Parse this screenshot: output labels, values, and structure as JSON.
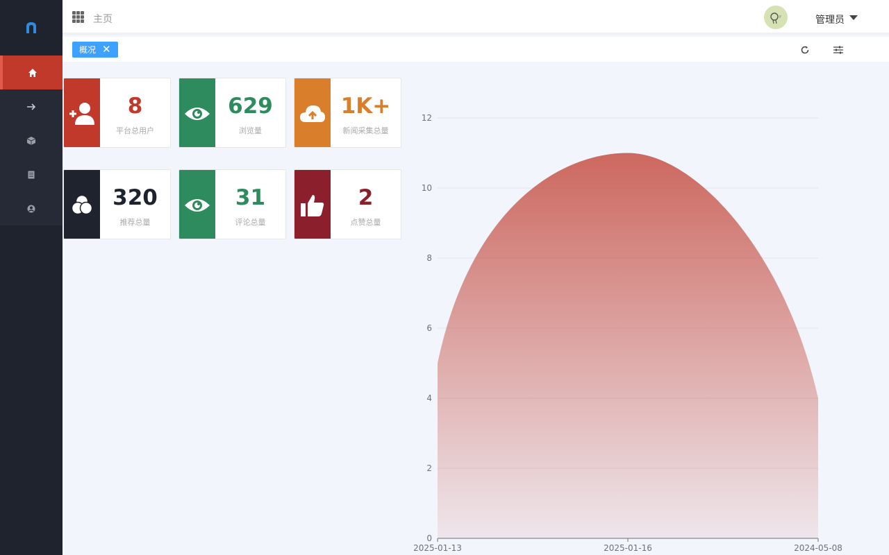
{
  "header": {
    "breadcrumb": "主页",
    "user_name": "管理员"
  },
  "tabs": [
    {
      "label": "概况",
      "close": "✕"
    }
  ],
  "sidebar": {
    "items": [
      {
        "icon": "home-icon",
        "active": true
      },
      {
        "icon": "arrow-right-icon",
        "active": false
      },
      {
        "icon": "cube-icon",
        "active": false
      },
      {
        "icon": "document-icon",
        "active": false
      },
      {
        "icon": "user-circle-icon",
        "active": false
      }
    ]
  },
  "stats": [
    {
      "value": "8",
      "label": "平台总用户",
      "color": "#c0392b",
      "icon": "add-user-icon"
    },
    {
      "value": "629",
      "label": "浏览量",
      "color": "#2e8b5e",
      "icon": "eye-icon"
    },
    {
      "value": "1K+",
      "label": "新闻采集总量",
      "color": "#d97f2b",
      "icon": "cloud-upload-icon"
    },
    {
      "value": "320",
      "label": "推荐总量",
      "color": "#1f232d",
      "icon": "recommend-icon"
    },
    {
      "value": "31",
      "label": "评论总量",
      "color": "#2e8b5e",
      "icon": "eye-icon"
    },
    {
      "value": "2",
      "label": "点赞总量",
      "color": "#8b1f2b",
      "icon": "thumbs-up-icon"
    }
  ],
  "chart_data": {
    "type": "area",
    "x": [
      "2025-01-13",
      "2025-01-16",
      "2024-05-08"
    ],
    "series": [
      {
        "values": [
          5,
          11,
          4
        ]
      }
    ],
    "ylim": [
      0,
      12
    ],
    "yticks": [
      0,
      2,
      4,
      6,
      8,
      10,
      12
    ],
    "grid": true,
    "smooth": true,
    "color": "#c0392b"
  }
}
